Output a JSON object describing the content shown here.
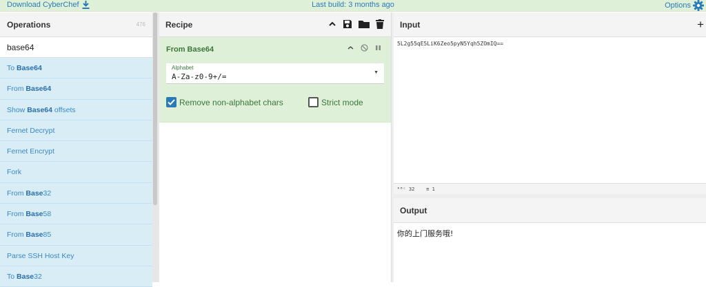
{
  "banner": {
    "download_label": "Download CyberChef",
    "build_label": "Last build: 3 months ago",
    "options_label": "Options"
  },
  "operations": {
    "title": "Operations",
    "count": "476",
    "search_value": "base64",
    "items": [
      {
        "pre": "To ",
        "bold": "Base64",
        "post": ""
      },
      {
        "pre": "From ",
        "bold": "Base64",
        "post": ""
      },
      {
        "pre": "Show ",
        "bold": "Base64",
        "post": " offsets"
      },
      {
        "pre": "Fernet Decrypt",
        "bold": "",
        "post": ""
      },
      {
        "pre": "Fernet Encrypt",
        "bold": "",
        "post": ""
      },
      {
        "pre": "Fork",
        "bold": "",
        "post": ""
      },
      {
        "pre": "From ",
        "bold": "Base",
        "post": "32"
      },
      {
        "pre": "From ",
        "bold": "Base",
        "post": "58"
      },
      {
        "pre": "From ",
        "bold": "Base",
        "post": "85"
      },
      {
        "pre": "Parse SSH Host Key",
        "bold": "",
        "post": ""
      },
      {
        "pre": "To ",
        "bold": "Base",
        "post": "32"
      }
    ]
  },
  "recipe": {
    "title": "Recipe",
    "operation": {
      "name": "From Base64",
      "alphabet_label": "Alphabet",
      "alphabet_value": "A-Za-z0-9+/=",
      "remove_label": "Remove non-alphabet chars",
      "remove_checked": true,
      "strict_label": "Strict mode",
      "strict_checked": false
    }
  },
  "input": {
    "title": "Input",
    "text": "5L2g55qE5LiK6Zeo5pyN5Yqh5ZOmIQ==",
    "status_chars": "32",
    "status_lines": "1"
  },
  "output": {
    "title": "Output",
    "text": "你的上门服务哦!"
  },
  "colors": {
    "accent": "#2a7ab8",
    "op_bg": "#d9edf7",
    "recipe_card_bg": "#dff0d8",
    "banner_bg": "#dff0d8"
  }
}
